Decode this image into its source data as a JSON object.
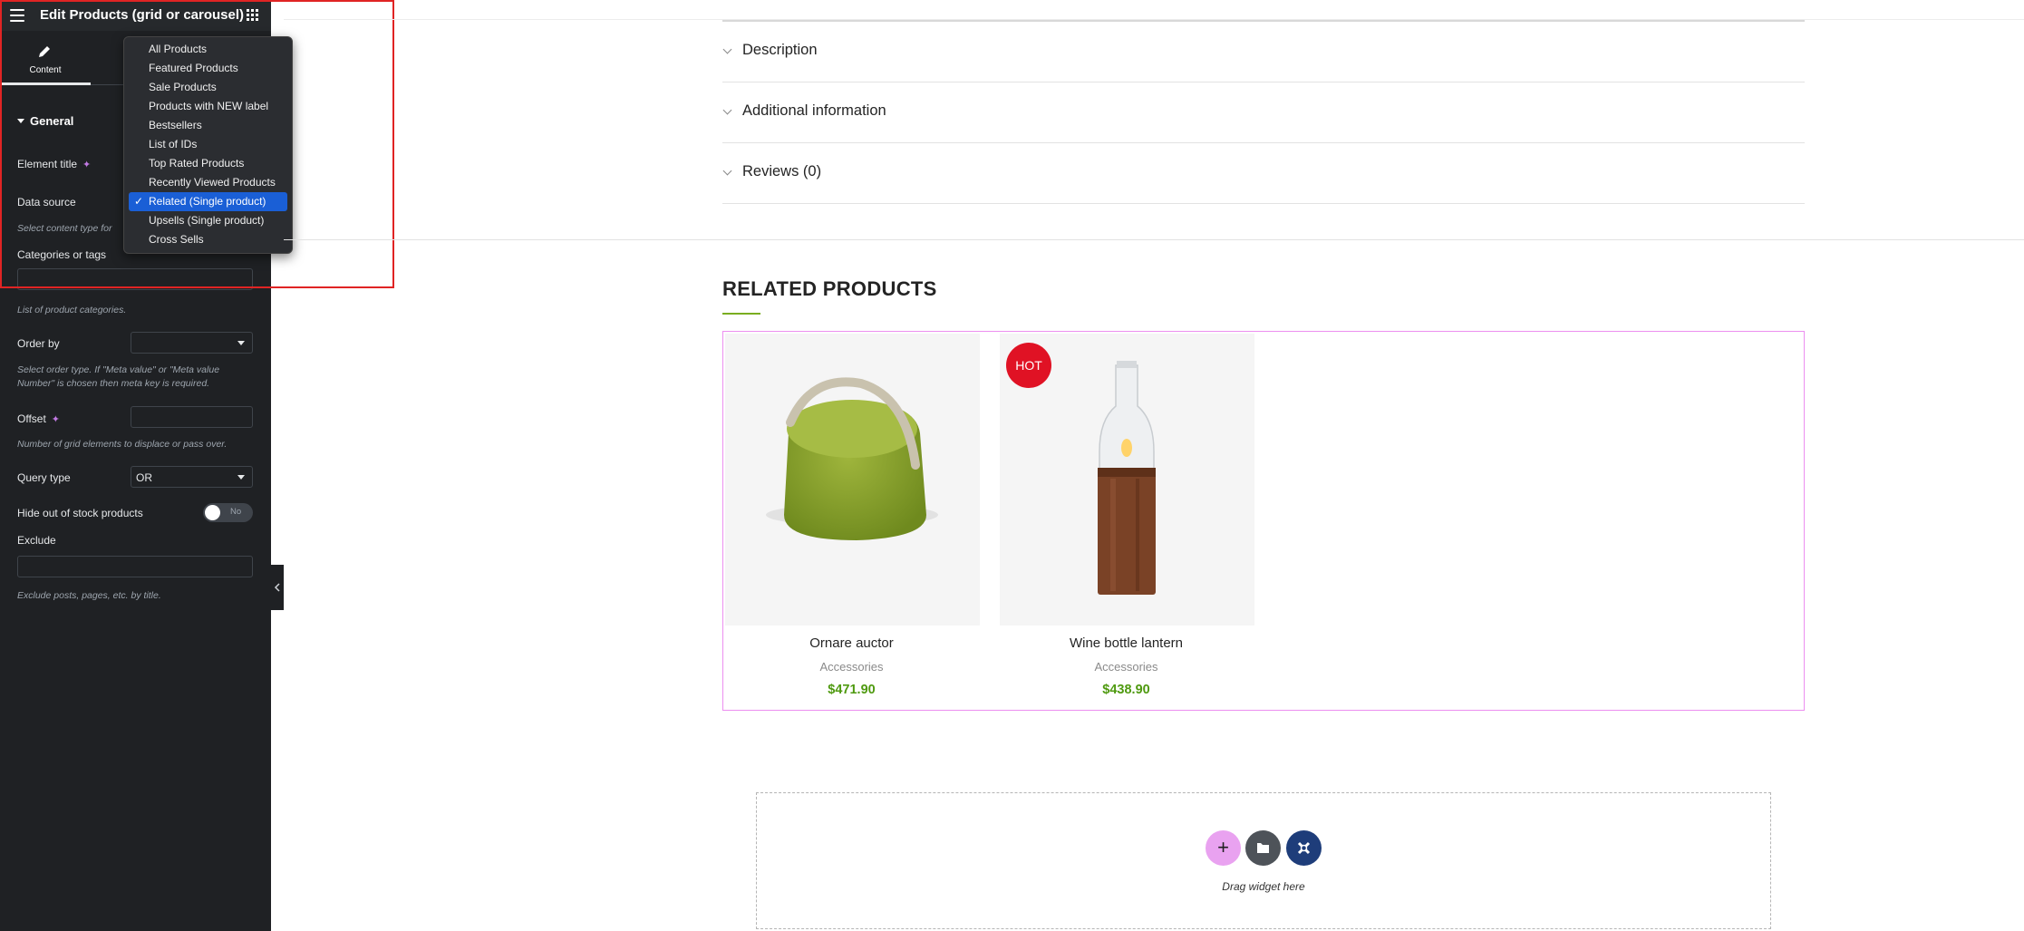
{
  "panel": {
    "title": "Edit Products (grid or carousel)",
    "tab_content": "Content",
    "section_general": "General",
    "element_title_label": "Element title",
    "data_source_label": "Data source",
    "data_source_desc": "Select content type for",
    "categories_label": "Categories or tags",
    "categories_desc": "List of product categories.",
    "order_by_label": "Order by",
    "order_by_value": "",
    "order_by_desc_1": "Select order type. If \"Meta value\" or \"Meta value",
    "order_by_desc_2": "Number\" is chosen then meta key is required.",
    "offset_label": "Offset",
    "offset_desc": "Number of grid elements to displace or pass over.",
    "query_type_label": "Query type",
    "query_type_value": "OR",
    "hide_oos_label": "Hide out of stock products",
    "hide_oos_toggle": "No",
    "exclude_label": "Exclude",
    "exclude_desc": "Exclude posts, pages, etc. by title.",
    "ai_icon": "✦"
  },
  "dropdown": {
    "selected_index": 8,
    "check": "✓",
    "options": [
      "All Products",
      "Featured Products",
      "Sale Products",
      "Products with NEW label",
      "Bestsellers",
      "List of IDs",
      "Top Rated Products",
      "Recently Viewed Products",
      "Related (Single product)",
      "Upsells (Single product)",
      "Cross Sells"
    ]
  },
  "accordion": [
    "Description",
    "Additional information",
    "Reviews (0)"
  ],
  "related": {
    "title": "RELATED PRODUCTS",
    "products": [
      {
        "name": "Ornare auctor",
        "category": "Accessories",
        "price": "$471.90",
        "badge": ""
      },
      {
        "name": "Wine bottle lantern",
        "category": "Accessories",
        "price": "$438.90",
        "badge": "HOT"
      }
    ]
  },
  "drop_zone": {
    "text": "Drag widget here",
    "add_icon": "+"
  },
  "colors": {
    "panel_bg": "#1f2124",
    "accent_green": "#4f9a10",
    "highlight_red": "#e02424",
    "selection_blue": "#1a5fd6",
    "hot_badge": "#e01224",
    "widget_border": "#ec8ff0"
  },
  "icons": [
    "hamburger-icon",
    "apps-grid-icon",
    "pencil-icon",
    "sparkle-ai-icon",
    "chevron-down-icon",
    "chevron-left-icon",
    "plus-icon",
    "folder-icon",
    "elementskit-icon",
    "checkmark-icon"
  ]
}
